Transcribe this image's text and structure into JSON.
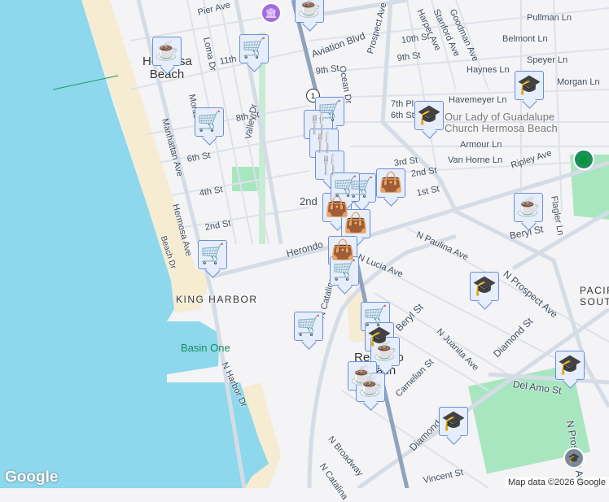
{
  "labels": {
    "pier_ave": "Pier Ave",
    "loma_dr": "Loma Dr",
    "hermosa_beach": "Hermosa Beach",
    "manhattan_ave": "Manhattan Ave",
    "monterey": "Monte",
    "eleventh": "11th",
    "eighth": "8th St",
    "valley_dr": "Valley Dr",
    "sixth_w": "6th St",
    "fourth_w": "4th St",
    "second_w": "2nd St",
    "hermosa_ave": "Hermosa Ave",
    "beach_dr": "Beach Dr",
    "aviation": "Aviation Blvd",
    "ocean_dr": "Ocean Dr",
    "prospect": "Prospect Ave",
    "tenth": "10th St",
    "ninth": "9th St",
    "ninth_w": "9th St",
    "harper": "Harper Ave",
    "stanford": "Stanford Ave",
    "goodman": "Goodman Ave",
    "pullman": "Pullman Ln",
    "belmont": "Belmont Ln",
    "speyer": "Speyer Ln",
    "haynes": "Haynes Ln",
    "morgan": "Morgan Ln",
    "havemeyer": "Havemeyer Ln",
    "seventh_pl": "7th Pl",
    "sixth_e": "6th St",
    "church": "Our Lady of Guadalupe Church Hermosa Beach",
    "armour": "Armour Ln",
    "van_horne": "Van Horne Ln",
    "ripley": "Ripley Ave",
    "flagler": "Flagler Ln",
    "third": "3rd St",
    "second_e": "2nd St",
    "first": "1st St",
    "second_c": "2nd",
    "paulina": "N Paulina Ave",
    "beryl": "Beryl St",
    "herondo": "Herondo",
    "lucia": "N Lucia Ave",
    "king_harbor": "KING HARBOR",
    "basin_one": "Basin One",
    "harbor_dr": "N Harbor Dr",
    "catalina": "N Catalina",
    "catalina2": "N Catalina",
    "redondo": "Redondo Beach",
    "beryl2": "Beryl St",
    "juanita": "N Juanita Ave",
    "carnelian": "Carnelian St",
    "broadway": "N Broadway",
    "diamond": "Diamond St",
    "diamond2": "Diamond",
    "vincent": "Vincent St",
    "n_prospect": "N Prospect Ave",
    "n_prospect2": "N Prospect Ave",
    "del_amo": "Del Amo St",
    "pacific_south": "PACIFIC SOUTH"
  },
  "markers": [
    "coffee",
    "cart",
    "cart",
    "cart",
    "coffee",
    "cart",
    "restaurant",
    "restaurant",
    "restaurant",
    "cart",
    "bag",
    "bag",
    "bag",
    "cart",
    "bag",
    "cart",
    "cart",
    "cart",
    "school",
    "coffee",
    "coffee",
    "coffee",
    "school",
    "school",
    "coffee",
    "school",
    "school",
    "school"
  ],
  "icons": {
    "coffee": "☕",
    "cart": "🛒",
    "restaurant": "🍴",
    "bag": "👜",
    "school": "🎓"
  },
  "route_shield": "1",
  "footer": {
    "logo": "Google",
    "credit": "Map data ©2026 Google"
  },
  "colors": {
    "water": "#8dd8ec",
    "sand": "#f6ecd2",
    "park": "#a8e6c0",
    "land": "#f4f3f5",
    "road": "#d5dce6",
    "highway": "#8ea3bd",
    "marker_fill": "#e6edfb",
    "marker_icon": "#0d3d63"
  }
}
